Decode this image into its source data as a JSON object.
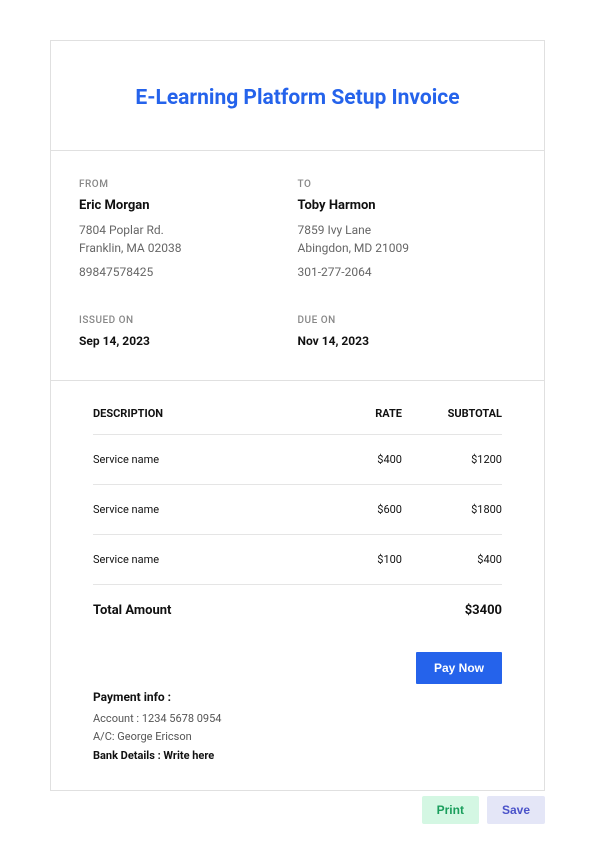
{
  "title": "E-Learning Platform Setup Invoice",
  "from": {
    "label": "FROM",
    "name": "Eric Morgan",
    "addr1": "7804 Poplar Rd.",
    "addr2": "Franklin, MA 02038",
    "phone": "89847578425"
  },
  "to": {
    "label": "TO",
    "name": "Toby Harmon",
    "addr1": "7859 Ivy Lane",
    "addr2": "Abingdon, MD 21009",
    "phone": "301-277-2064"
  },
  "issued": {
    "label": "ISSUED ON",
    "value": "Sep 14, 2023"
  },
  "due": {
    "label": "DUE ON",
    "value": "Nov 14, 2023"
  },
  "columns": {
    "desc": "DESCRIPTION",
    "rate": "RATE",
    "sub": "SUBTOTAL"
  },
  "items": [
    {
      "desc": "Service name",
      "rate": "$400",
      "sub": "$1200"
    },
    {
      "desc": "Service name",
      "rate": "$600",
      "sub": "$1800"
    },
    {
      "desc": "Service name",
      "rate": "$100",
      "sub": "$400"
    }
  ],
  "total": {
    "label": "Total Amount",
    "value": "$3400"
  },
  "paynow": "Pay Now",
  "payment": {
    "title": "Payment info :",
    "account": "Account :  1234 5678 0954",
    "ac": "A/C:  George Ericson",
    "bank": "Bank Details :  Write here"
  },
  "actions": {
    "print": "Print",
    "save": "Save"
  }
}
